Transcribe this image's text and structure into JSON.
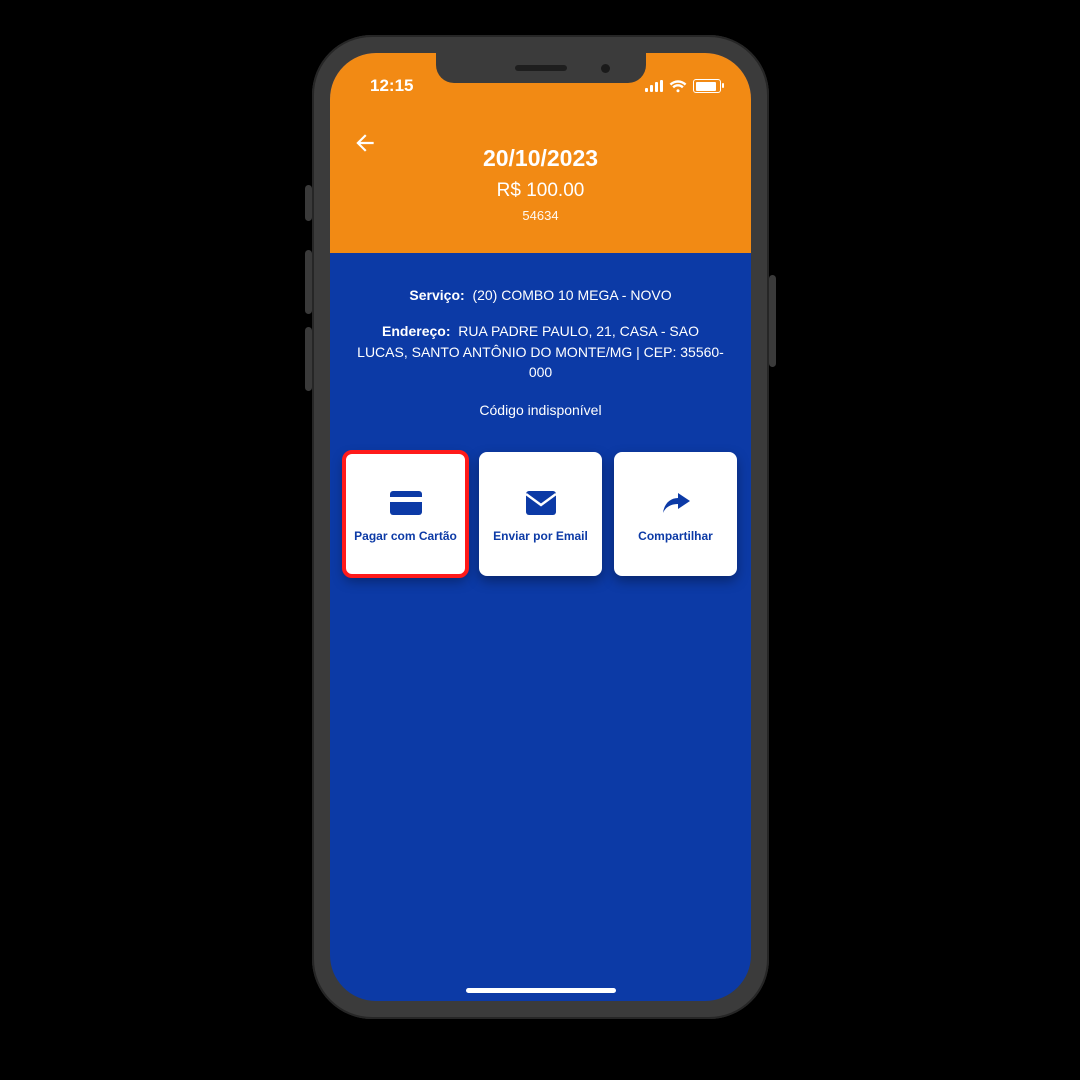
{
  "status": {
    "time": "12:15"
  },
  "header": {
    "date": "20/10/2023",
    "amount": "R$ 100.00",
    "code": "54634"
  },
  "details": {
    "service_label": "Serviço:",
    "service_value": "(20) COMBO 10 MEGA - NOVO",
    "address_label": "Endereço:",
    "address_value": "RUA PADRE PAULO, 21, CASA - SAO LUCAS, SANTO ANTÔNIO DO MONTE/MG | CEP: 35560-000",
    "barcode_status": "Código indisponível"
  },
  "actions": {
    "pay_card": "Pagar com Cartão",
    "email": "Enviar por Email",
    "share": "Compartilhar"
  }
}
